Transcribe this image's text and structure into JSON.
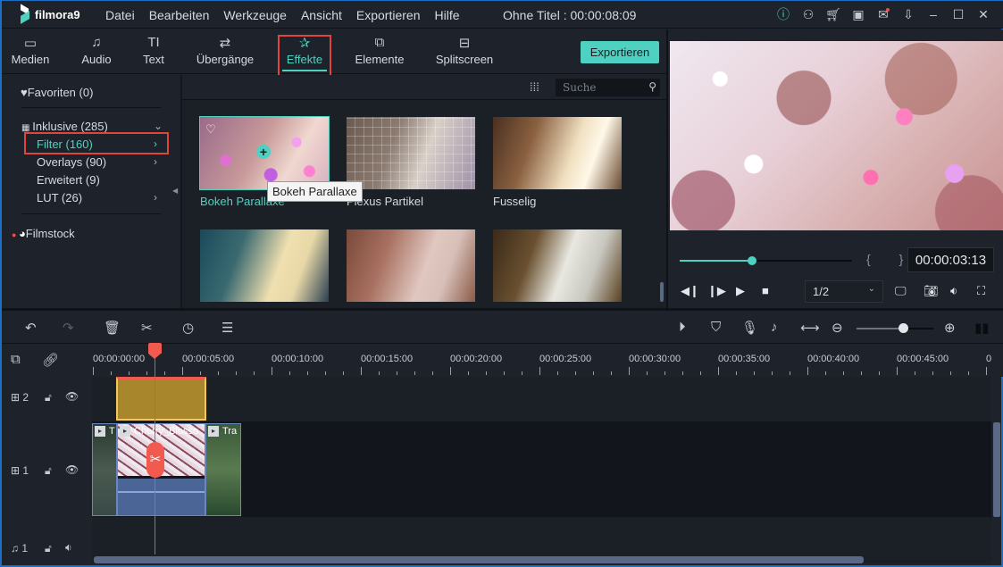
{
  "app": {
    "logo_text": "filmora9",
    "document_title": "Ohne Titel : 00:00:08:09"
  },
  "menu": [
    "Datei",
    "Bearbeiten",
    "Werkzeuge",
    "Ansicht",
    "Exportieren",
    "Hilfe"
  ],
  "titlebar_icons": [
    "info-icon",
    "account-icon",
    "cart-icon",
    "save-icon",
    "mail-icon",
    "download-icon",
    "minimize-icon",
    "maximize-icon",
    "close-icon"
  ],
  "tabs": [
    {
      "label": "Medien",
      "icon": "folder-icon"
    },
    {
      "label": "Audio",
      "icon": "music-note-icon"
    },
    {
      "label": "Text",
      "icon": "text-icon"
    },
    {
      "label": "Übergänge",
      "icon": "transitions-icon"
    },
    {
      "label": "Effekte",
      "icon": "effects-icon",
      "active": true
    },
    {
      "label": "Elemente",
      "icon": "elements-icon"
    },
    {
      "label": "Splitscreen",
      "icon": "splitscreen-icon"
    }
  ],
  "export_label": "Exportieren",
  "library": {
    "favorites": "Favoriten (0)",
    "included": "Inklusive (285)",
    "items": [
      {
        "label": "Filter (160)",
        "selected": true,
        "has_arrow": true
      },
      {
        "label": "Overlays (90)",
        "has_arrow": true
      },
      {
        "label": "Erweitert (9)",
        "has_arrow": false
      },
      {
        "label": "LUT (26)",
        "has_arrow": true
      }
    ],
    "filmstock": "Filmstock"
  },
  "effects": {
    "search_placeholder": "Suche",
    "tooltip": "Bokeh Parallaxe",
    "items": [
      {
        "label": "Bokeh Parallaxe",
        "selected": true
      },
      {
        "label": "Plexus Partikel"
      },
      {
        "label": "Fusselig"
      },
      {
        "label": ""
      },
      {
        "label": ""
      },
      {
        "label": ""
      }
    ]
  },
  "preview": {
    "progress": 0.42,
    "time": "00:00:03:13",
    "quality": "1/2"
  },
  "timeline": {
    "zoom_level": 0.6,
    "ruler_labels": [
      "00:00:00:00",
      "00:00:05:00",
      "00:00:10:00",
      "00:00:15:00",
      "00:00:20:00",
      "00:00:25:00",
      "00:00:30:00",
      "00:00:35:00",
      "00:00:40:00",
      "00:00:45:00",
      "0"
    ],
    "tracks": [
      {
        "name": "video-track-2",
        "number": "2"
      },
      {
        "name": "video-track-1",
        "number": "1"
      },
      {
        "name": "audio-track-1",
        "number": "1"
      }
    ],
    "clips": [
      {
        "label": "T"
      },
      {
        "label": "Cherry_Blosso"
      },
      {
        "label": "Tra"
      }
    ]
  },
  "colors": {
    "accent": "#4fd1c1",
    "highlight_box": "#e0453c",
    "playhead": "#f25a50",
    "overlay_clip": "#a8872c",
    "video_clip": "#4a6596"
  }
}
